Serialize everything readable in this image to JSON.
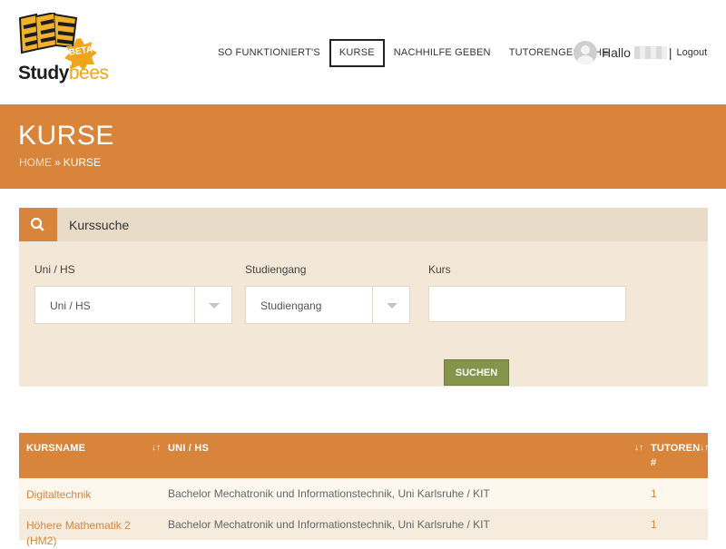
{
  "brand": {
    "name_part1": "Study",
    "name_part2": "bees",
    "badge": "BETA"
  },
  "nav": {
    "items": [
      {
        "label": "SO FUNKTIONIERT'S",
        "active": false
      },
      {
        "label": "KURSE",
        "active": true
      },
      {
        "label": "NACHHILFE GEBEN",
        "active": false
      },
      {
        "label": "TUTORENGESUCHE",
        "active": false
      }
    ]
  },
  "user": {
    "greeting": "Hallo",
    "separator": "|",
    "logout_label": "Logout"
  },
  "banner": {
    "title": "KURSE",
    "breadcrumb_home": "HOME",
    "breadcrumb_sep": "»",
    "breadcrumb_current": "KURSE"
  },
  "search": {
    "title": "Kurssuche",
    "uni_label": "Uni / HS",
    "uni_value": "Uni / HS",
    "studiengang_label": "Studiengang",
    "studiengang_value": "Studiengang",
    "kurs_label": "Kurs",
    "kurs_value": "",
    "button_label": "SUCHEN"
  },
  "table": {
    "headers": {
      "kursname": "KURSNAME",
      "uni": "UNI / HS",
      "tutoren_line1": "TUTOREN",
      "tutoren_line2": "#"
    },
    "rows": [
      {
        "name": "Digitaltechnik",
        "uni": "Bachelor Mechatronik und Informationstechnik, Uni Karlsruhe / KIT",
        "count": "1"
      },
      {
        "name": "Höhere Mathematik 2 (HM2)",
        "uni": "Bachelor Mechatronik und Informationstechnik, Uni Karlsruhe / KIT",
        "count": "1"
      }
    ]
  },
  "colors": {
    "accent": "#d9843b",
    "panel_bg": "#f3e8d7",
    "button_green": "#84944a"
  }
}
